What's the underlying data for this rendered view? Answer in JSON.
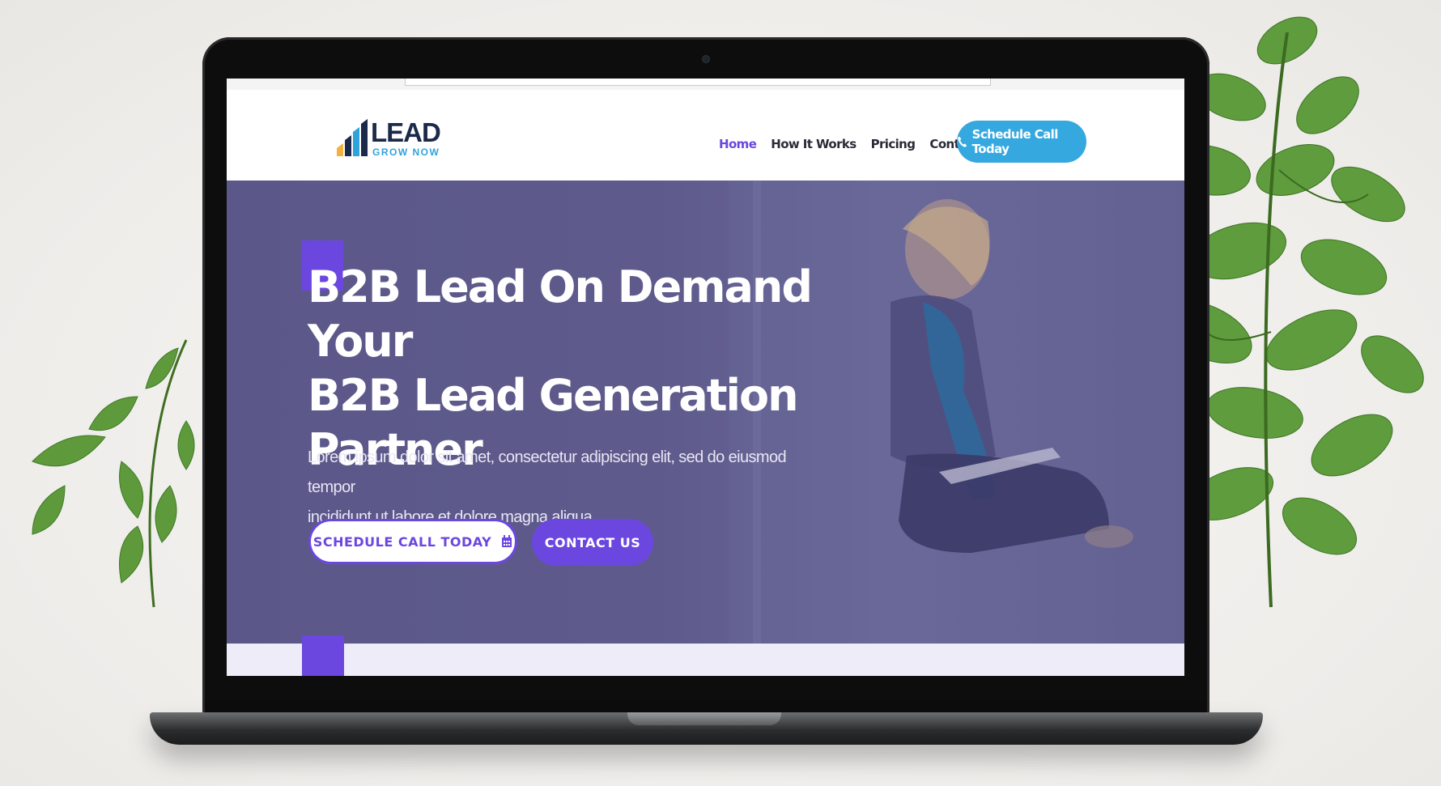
{
  "header": {
    "logo": {
      "word": "LEAD",
      "sub": "GROW NOW"
    },
    "nav": [
      {
        "label": "Home",
        "active": true
      },
      {
        "label": "How It Works",
        "active": false
      },
      {
        "label": "Pricing",
        "active": false
      },
      {
        "label": "Contact Us",
        "active": false
      }
    ],
    "cta": {
      "label": "Schedule Call Today",
      "icon": "phone-icon"
    }
  },
  "hero": {
    "title_lines": [
      "B2B Lead On Demand Your",
      "B2B Lead Generation",
      "Partner"
    ],
    "text_lines": [
      "Lorem ipsum dolor sit amet, consectetur adipiscing elit, sed do eiusmod tempor",
      "incididunt ut labore et dolore magna aliqua."
    ],
    "buttons": {
      "schedule": {
        "label": "SCHEDULE CALL TODAY",
        "icon": "calendar-icon"
      },
      "contact": {
        "label": "CONTACT US"
      }
    }
  },
  "colors": {
    "accent": "#6b47e0",
    "cta_blue": "#35a8e0",
    "hero_overlay": "#5e5b8c",
    "logo_navy": "#1b2a4a"
  }
}
